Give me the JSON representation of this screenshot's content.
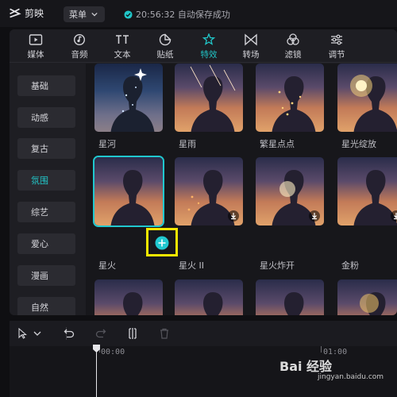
{
  "app": {
    "name": "剪映",
    "menu_label": "菜单",
    "save_status": "20:56:32 自动保存成功"
  },
  "colors": {
    "accent": "#21c6c8",
    "highlight": "#f6e800",
    "background": "#0f0f12"
  },
  "toolbar": {
    "items": [
      {
        "label": "媒体",
        "icon": "media-icon"
      },
      {
        "label": "音频",
        "icon": "audio-icon"
      },
      {
        "label": "文本",
        "icon": "text-icon"
      },
      {
        "label": "贴纸",
        "icon": "sticker-icon"
      },
      {
        "label": "特效",
        "icon": "effects-icon",
        "active": true
      },
      {
        "label": "转场",
        "icon": "transition-icon"
      },
      {
        "label": "滤镜",
        "icon": "filter-icon"
      },
      {
        "label": "调节",
        "icon": "adjust-icon"
      }
    ]
  },
  "sidebar": {
    "items": [
      {
        "label": "基础"
      },
      {
        "label": "动感"
      },
      {
        "label": "复古"
      },
      {
        "label": "氛围",
        "active": true
      },
      {
        "label": "综艺"
      },
      {
        "label": "爱心"
      },
      {
        "label": "漫画"
      },
      {
        "label": "自然"
      }
    ]
  },
  "effects": {
    "row1": [
      {
        "label": "星河"
      },
      {
        "label": "星雨"
      },
      {
        "label": "繁星点点"
      },
      {
        "label": "星光绽放"
      }
    ],
    "row2": [
      {
        "label": "星火",
        "selected": true
      },
      {
        "label": "星火 II"
      },
      {
        "label": "星火炸开"
      },
      {
        "label": "金粉"
      }
    ]
  },
  "timeline": {
    "start_time": "00:00",
    "mark_time": "01:00"
  },
  "watermark": {
    "text": "Bai 经验",
    "sub": "jingyan.baidu.com"
  }
}
